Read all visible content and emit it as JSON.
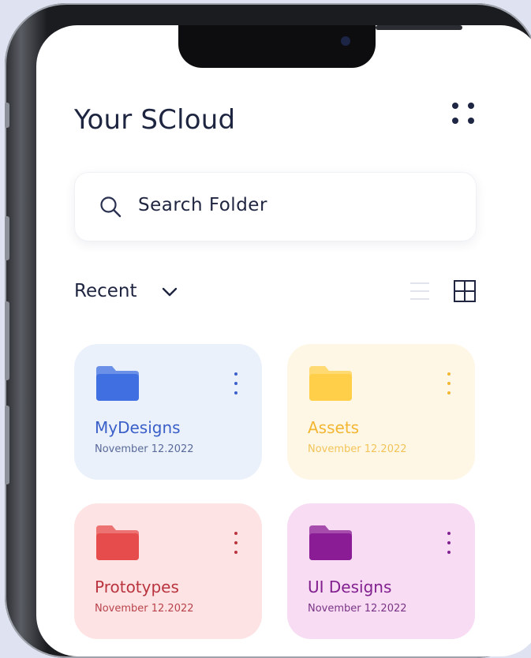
{
  "page": {
    "title": "Your SCloud"
  },
  "search": {
    "placeholder": "Search Folder"
  },
  "filter": {
    "label": "Recent"
  },
  "folders": [
    {
      "name": "MyDesigns",
      "date": "November 12.2022",
      "bg": "#eaf1fb",
      "folder_color": "#3f6fe0",
      "text_color": "#3a5fc8",
      "date_color": "#5a6a9a"
    },
    {
      "name": "Assets",
      "date": "November 12.2022",
      "bg": "#fff7e6",
      "folder_color": "#ffcf4a",
      "text_color": "#f2b632",
      "date_color": "#f2c458"
    },
    {
      "name": "Prototypes",
      "date": "November 12.2022",
      "bg": "#fde3e3",
      "folder_color": "#e74c4c",
      "text_color": "#b9343f",
      "date_color": "#b9434c"
    },
    {
      "name": "UI Designs",
      "date": "November 12.2022",
      "bg": "#f7dcf4",
      "folder_color": "#8a1c96",
      "text_color": "#82208f",
      "date_color": "#7a3484"
    }
  ]
}
